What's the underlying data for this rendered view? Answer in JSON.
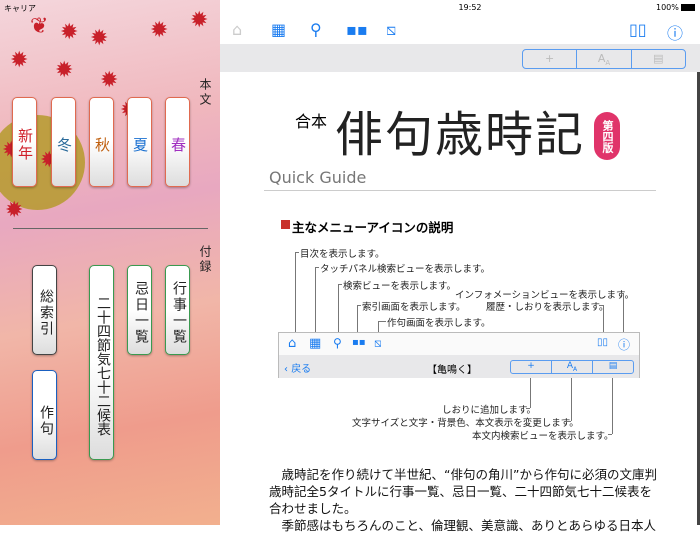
{
  "status": {
    "carrier": "キャリア",
    "time": "19:52",
    "battery": "100%"
  },
  "sidebar": {
    "section1_label": "本文",
    "seasons": [
      {
        "label": "新年",
        "color": "#d0202a"
      },
      {
        "label": "冬",
        "color": "#2a6a9a"
      },
      {
        "label": "秋",
        "color": "#c06010"
      },
      {
        "label": "夏",
        "color": "#1a70d0"
      },
      {
        "label": "春",
        "color": "#a030c0"
      }
    ],
    "section2_label": "付録",
    "appendix": [
      "行事一覧",
      "忌日一覧",
      "二十四節気七十二候表",
      "総索引",
      "作句"
    ]
  },
  "toolbar": {
    "icons": [
      "home-icon",
      "grid-icon",
      "search-icon",
      "index-icon",
      "compose-icon",
      "book-icon",
      "info-icon"
    ],
    "seg": [
      "+",
      "AA",
      "search-doc"
    ]
  },
  "doc": {
    "title_prefix": "合本",
    "title": "俳句歳時記",
    "edition": "第四版",
    "subtitle": "Quick Guide",
    "section_heading": "主なメニューアイコンの説明",
    "diagram": {
      "labels": [
        "目次を表示します。",
        "タッチパネル検索ビューを表示します。",
        "検索ビューを表示します。",
        "インフォメーションビューを表示します。",
        "索引画面を表示します。",
        "履歴・しおりを表示します。",
        "作句画面を表示します。"
      ],
      "back": "戻る",
      "page_title": "【亀鳴く】",
      "bottom_labels": [
        "しおりに追加します。",
        "文字サイズと文字・背景色、本文表示を変更します。",
        "本文内検索ビューを表示します。"
      ]
    },
    "paragraphs": [
      "　歳時記を作り続けて半世紀、“俳句の角川”から作句に必須の文庫判歳時記全5タイトルに行事一覧、忌日一覧、二十四節気七十二候表を合わせました。",
      "　季節感はもちろんのこと、倫理観、美意識、ありとあらゆる日本人"
    ]
  },
  "colors": {
    "accent": "#1a7cf0",
    "edition_badge": "#e0346a",
    "heading_square": "#c8302a"
  }
}
